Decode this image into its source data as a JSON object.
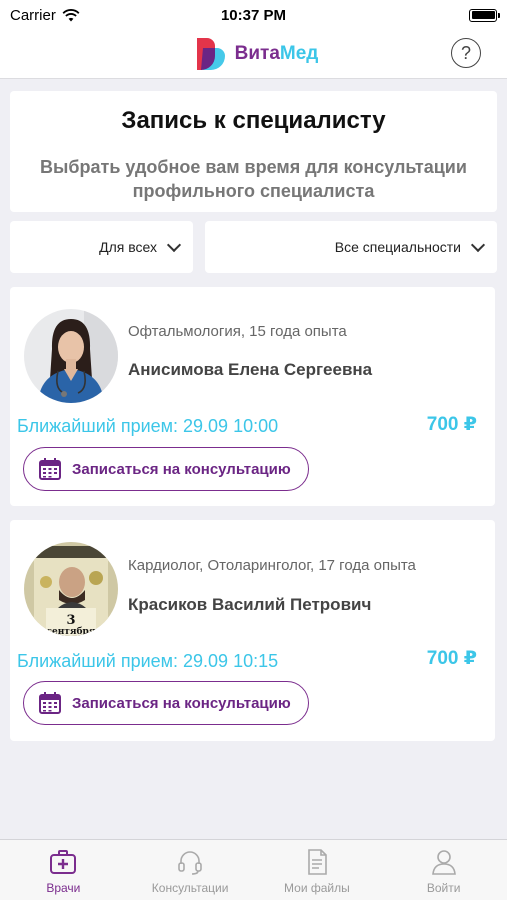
{
  "status": {
    "carrier": "Carrier",
    "time": "10:37 PM"
  },
  "header": {
    "brand_part1": "Вита",
    "brand_part2": "Мед",
    "help_symbol": "?"
  },
  "title_card": {
    "title": "Запись к специалисту",
    "subtitle": "Выбрать удобное вам время для консультации профильного специалиста"
  },
  "filters": {
    "audience": "Для всех",
    "specialty": "Все специальности"
  },
  "doctors": [
    {
      "meta": "Офтальмология, 15 года опыта",
      "name": "Анисимова Елена Сергеевна",
      "next": "Ближайший прием: 29.09 10:00",
      "price": "700 ₽",
      "book_label": "Записаться на консультацию"
    },
    {
      "meta": "Кардиолог, Отоларинголог, 17 года опыта",
      "name": "Красиков Василий Петрович",
      "next": "Ближайший прием: 29.09 10:15",
      "price": "700 ₽",
      "book_label": "Записаться на консультацию",
      "avatar_text_number": "3",
      "avatar_text_month": "сентября"
    }
  ],
  "tabs": [
    {
      "label": "Врачи",
      "icon": "medkit-icon",
      "active": true
    },
    {
      "label": "Консультации",
      "icon": "headset-icon",
      "active": false
    },
    {
      "label": "Мои файлы",
      "icon": "document-icon",
      "active": false
    },
    {
      "label": "Войти",
      "icon": "user-icon",
      "active": false
    }
  ],
  "colors": {
    "accent_purple": "#7b2d8e",
    "accent_cyan": "#3cc6e8",
    "background": "#efeff4"
  }
}
